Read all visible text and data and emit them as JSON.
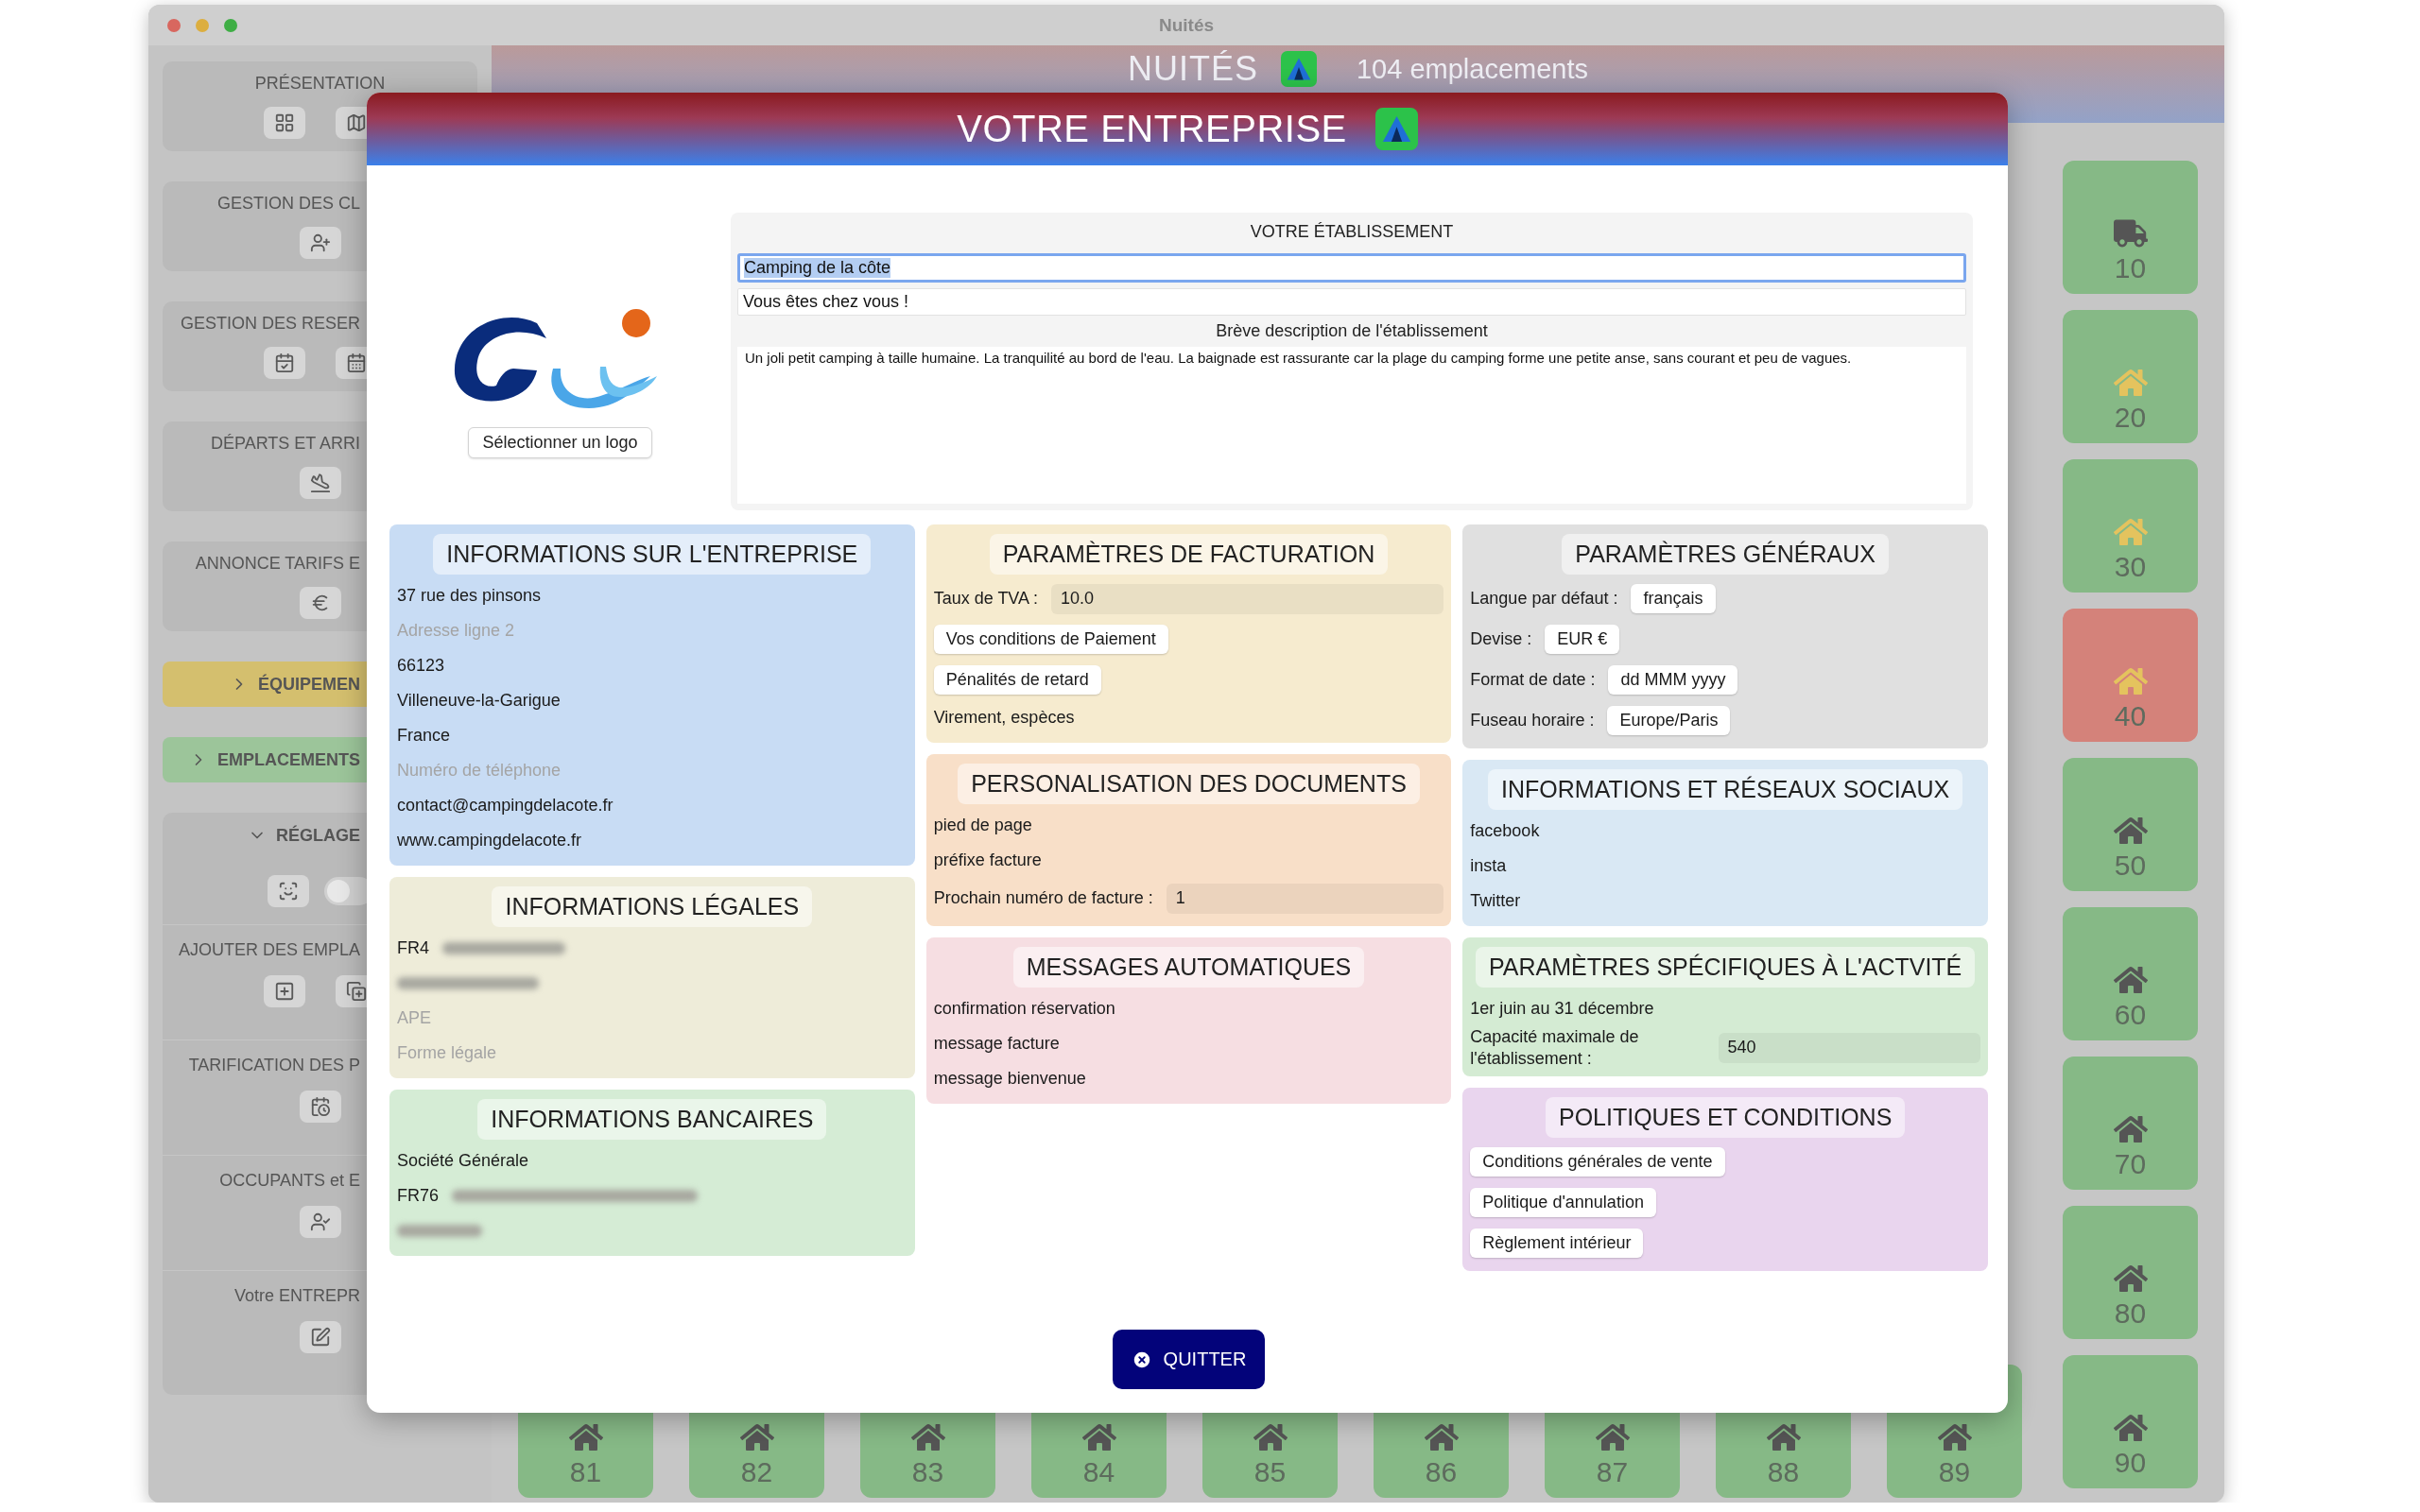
{
  "window": {
    "title": "Nuités"
  },
  "sidebar": {
    "sections": [
      {
        "kind": "section",
        "title": "PRÉSENTATION"
      },
      {
        "kind": "section",
        "title": "GESTION DES CL"
      },
      {
        "kind": "section",
        "title": "GESTION DES RESER"
      },
      {
        "kind": "section",
        "title": "DÉPARTS ET ARRI"
      },
      {
        "kind": "section",
        "title": "ANNONCE TARIFS E"
      },
      {
        "kind": "collapsible",
        "title": "ÉQUIPEMEN",
        "expanded": false,
        "color": "#d4bf6e"
      },
      {
        "kind": "collapsible",
        "title": "EMPLACEMENTS",
        "expanded": false,
        "color": "#9cc59a"
      },
      {
        "kind": "group",
        "title": "RÉGLAGE",
        "expanded": true,
        "toggle": {
          "on": false
        },
        "children": [
          {
            "title": "AJOUTER DES EMPLA"
          },
          {
            "title": "TARIFICATION DES P"
          },
          {
            "title": "OCCUPANTS et E"
          },
          {
            "title": "Votre ENTREPR"
          }
        ]
      }
    ]
  },
  "header": {
    "title": "NUITÉS",
    "count": "104 emplacements"
  },
  "tiles": {
    "right_column": [
      {
        "label": "10",
        "kind": "truck",
        "marked": false,
        "color": "#86b986"
      },
      {
        "label": "20",
        "kind": "house",
        "marked": true,
        "color": "#86b986"
      },
      {
        "label": "30",
        "kind": "house",
        "marked": true,
        "color": "#86b986"
      },
      {
        "label": "40",
        "kind": "house",
        "marked": true,
        "color": "#d4827a"
      },
      {
        "label": "50",
        "kind": "house",
        "marked": false,
        "color": "#86b986"
      },
      {
        "label": "60",
        "kind": "house",
        "marked": false,
        "color": "#86b986"
      },
      {
        "label": "70",
        "kind": "house",
        "marked": false,
        "color": "#86b986"
      },
      {
        "label": "80",
        "kind": "house",
        "marked": false,
        "color": "#86b986"
      },
      {
        "label": "90",
        "kind": "house",
        "marked": false,
        "color": "#86b986"
      }
    ],
    "bottom_row": [
      {
        "label": "81",
        "kind": "house",
        "marked": false,
        "color": "#86b986"
      },
      {
        "label": "82",
        "kind": "house",
        "marked": false,
        "color": "#86b986"
      },
      {
        "label": "83",
        "kind": "house",
        "marked": false,
        "color": "#86b986"
      },
      {
        "label": "84",
        "kind": "house",
        "marked": false,
        "color": "#86b986"
      },
      {
        "label": "85",
        "kind": "house",
        "marked": false,
        "color": "#86b986"
      },
      {
        "label": "86",
        "kind": "house",
        "marked": false,
        "color": "#86b986"
      },
      {
        "label": "87",
        "kind": "house",
        "marked": false,
        "color": "#86b986"
      },
      {
        "label": "88",
        "kind": "house",
        "marked": false,
        "color": "#86b986"
      },
      {
        "label": "89",
        "kind": "house",
        "marked": false,
        "color": "#86b986"
      }
    ]
  },
  "modal": {
    "title": "VOTRE ENTREPRISE",
    "logo_button": "Sélectionner un logo",
    "establishment": {
      "heading": "VOTRE ÉTABLISSEMENT",
      "name": {
        "value": "Camping de la côte",
        "focused": true
      },
      "slogan": {
        "value": "Vous êtes chez vous !"
      },
      "description_label": "Brève description de l'établissement",
      "description": "Un joli petit camping à taille humaine. La tranquilité au bord de l'eau. La baignade est rassurante car la plage du camping forme une petite anse, sans courant et peu de vagues."
    },
    "columns": [
      [
        {
          "title": "INFORMATIONS SUR L'ENTREPRISE",
          "color": "#c8dcf4",
          "items": [
            {
              "kind": "field",
              "value": "37 rue des pinsons"
            },
            {
              "kind": "field",
              "placeholder": "Adresse ligne 2"
            },
            {
              "kind": "field",
              "value": "66123"
            },
            {
              "kind": "field",
              "value": "Villeneuve-la-Garigue"
            },
            {
              "kind": "field",
              "value": "France"
            },
            {
              "kind": "field",
              "placeholder": "Numéro de téléphone"
            },
            {
              "kind": "field",
              "value": "contact@campingdelacote.fr"
            },
            {
              "kind": "field",
              "value": "www.campingdelacote.fr"
            }
          ]
        },
        {
          "title": "INFORMATIONS LÉGALES",
          "color": "#eeecd9",
          "items": [
            {
              "kind": "redacted",
              "value": "FR4"
            },
            {
              "kind": "redacted"
            },
            {
              "kind": "field",
              "placeholder": "APE"
            },
            {
              "kind": "field",
              "placeholder": "Forme légale"
            }
          ]
        },
        {
          "title": "INFORMATIONS BANCAIRES",
          "color": "#d5ecd5",
          "items": [
            {
              "kind": "field",
              "value": "Société Générale"
            },
            {
              "kind": "redacted",
              "value": "FR76"
            },
            {
              "kind": "redacted"
            }
          ]
        }
      ],
      [
        {
          "title": "PARAMÈTRES DE FACTURATION",
          "color": "#f6ebcf",
          "items": [
            {
              "kind": "labeled",
              "label": "Taux de TVA :",
              "value": "10.0"
            },
            {
              "kind": "button",
              "label": "Vos conditions de Paiement"
            },
            {
              "kind": "button",
              "label": "Pénalités de retard"
            },
            {
              "kind": "field",
              "value": "Virement, espèces"
            }
          ]
        },
        {
          "title": "PERSONALISATION DES DOCUMENTS",
          "color": "#f8dfc8",
          "items": [
            {
              "kind": "field",
              "value": "pied de page"
            },
            {
              "kind": "field",
              "value": "préfixe facture"
            },
            {
              "kind": "labeled",
              "label": "Prochain numéro de facture :",
              "value": "1"
            }
          ]
        },
        {
          "title": "MESSAGES AUTOMATIQUES",
          "color": "#f6dee2",
          "items": [
            {
              "kind": "field",
              "value": "confirmation réservation"
            },
            {
              "kind": "field",
              "value": "message facture"
            },
            {
              "kind": "field",
              "value": "message bienvenue"
            }
          ]
        }
      ],
      [
        {
          "title": "PARAMÈTRES GÉNÉRAUX",
          "color": "#e0e0e0",
          "items": [
            {
              "kind": "select",
              "label": "Langue par défaut :",
              "value": "français"
            },
            {
              "kind": "select",
              "label": "Devise :",
              "value": "EUR €"
            },
            {
              "kind": "select",
              "label": "Format de date :",
              "value": "dd MMM yyyy"
            },
            {
              "kind": "select",
              "label": "Fuseau horaire :",
              "value": "Europe/Paris"
            }
          ]
        },
        {
          "title": "INFORMATIONS ET RÉSEAUX SOCIAUX",
          "color": "#d9e8f4",
          "items": [
            {
              "kind": "field",
              "value": "facebook"
            },
            {
              "kind": "field",
              "value": "insta"
            },
            {
              "kind": "field",
              "value": "Twitter"
            }
          ]
        },
        {
          "title": "PARAMÈTRES SPÉCIFIQUES À L'ACTVITÉ",
          "color": "#d4ebd3",
          "items": [
            {
              "kind": "field",
              "value": "1er juin au 31 décembre"
            },
            {
              "kind": "labeled",
              "label": "Capacité maximale de l'établissement :",
              "value": "540"
            }
          ]
        },
        {
          "title": "POLITIQUES ET CONDITIONS",
          "color": "#e9d5ee",
          "items": [
            {
              "kind": "button",
              "label": "Conditions générales de vente"
            },
            {
              "kind": "button",
              "label": "Politique d'annulation"
            },
            {
              "kind": "button",
              "label": "Règlement intérieur"
            }
          ]
        }
      ]
    ],
    "quit_button": "QUITTER"
  }
}
